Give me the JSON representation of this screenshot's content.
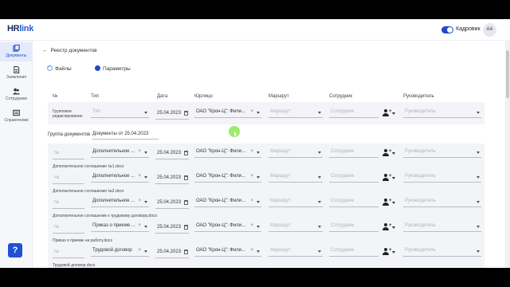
{
  "app": {
    "logo_prefix": "HR",
    "logo_suffix": "link",
    "mode_label": "Кадровик",
    "avatar_initials": "AA"
  },
  "sidebar": {
    "items": [
      {
        "label": "Документы",
        "icon": "documents-icon",
        "active": true
      },
      {
        "label": "Заявления",
        "icon": "application-icon",
        "active": false
      },
      {
        "label": "Сотрудники",
        "icon": "employees-icon",
        "active": false
      },
      {
        "label": "Справочники",
        "icon": "reference-icon",
        "active": false
      }
    ],
    "help_label": "?"
  },
  "breadcrumb": {
    "label": "Реестр документов"
  },
  "tabs": [
    {
      "label": "Файлы",
      "state": "checked"
    },
    {
      "label": "Параметры",
      "state": "selected"
    }
  ],
  "columns": [
    "№",
    "Тип",
    "Дата",
    "Юрлицо",
    "Маршрут",
    "Сотрудник",
    "Руководитель"
  ],
  "group_edit": {
    "label_line1": "Групповое",
    "label_line2": "редактирование",
    "type_placeholder": "Тип",
    "date": "25.04.2023",
    "company": "ОАО \"Крон-Ц\": Фили...",
    "route_placeholder": "Маршрут",
    "employee_placeholder": "Сотрудник",
    "manager_placeholder": "Руководитель"
  },
  "doc_group": {
    "label": "Группа документов",
    "value": "Документы от 25.04.2023"
  },
  "rows": [
    {
      "num_placeholder": "№",
      "type": "Дополнительное ...",
      "date": "25.04.2023",
      "company": "ОАО \"Крон-Ц\": Фили...",
      "route_placeholder": "Маршрут",
      "employee_placeholder": "Сотрудник",
      "manager_placeholder": "Руководитель",
      "file": "Дополнительное соглашение №1.docx"
    },
    {
      "num_placeholder": "№",
      "type": "Дополнительное ...",
      "date": "25.04.2023",
      "company": "ОАО \"Крон-Ц\": Фили...",
      "route_placeholder": "Маршрут",
      "employee_placeholder": "Сотрудник",
      "manager_placeholder": "Руководитель",
      "file": "Дополнительное соглашение №2.docx"
    },
    {
      "num_placeholder": "№",
      "type": "Дополнительное ...",
      "date": "25.04.2023",
      "company": "ОАО \"Крон-Ц\": Фили...",
      "route_placeholder": "Маршрут",
      "employee_placeholder": "Сотрудник",
      "manager_placeholder": "Руководитель",
      "file": "Дополнительное соглашение к трудовому договору.docx"
    },
    {
      "num_placeholder": "№",
      "type": "Приказ о приеме ...",
      "date": "25.04.2023",
      "company": "ОАО \"Крон-Ц\": Фили...",
      "route_placeholder": "Маршрут",
      "employee_placeholder": "Сотрудник",
      "manager_placeholder": "Руководитель",
      "file": "Приказ о приеме на работу.docx"
    },
    {
      "num_placeholder": "№",
      "type": "Трудовой договор",
      "date": "25.04.2023",
      "company": "ОАО \"Крон-Ц\": Фили...",
      "route_placeholder": "Маршрут",
      "employee_placeholder": "Сотрудник",
      "manager_placeholder": "Руководитель",
      "file": "Трудовой договор.docx"
    }
  ],
  "colors": {
    "accent": "#1e49c9",
    "help_button": "#2251d6",
    "cursor_highlight": "#78e63c"
  }
}
